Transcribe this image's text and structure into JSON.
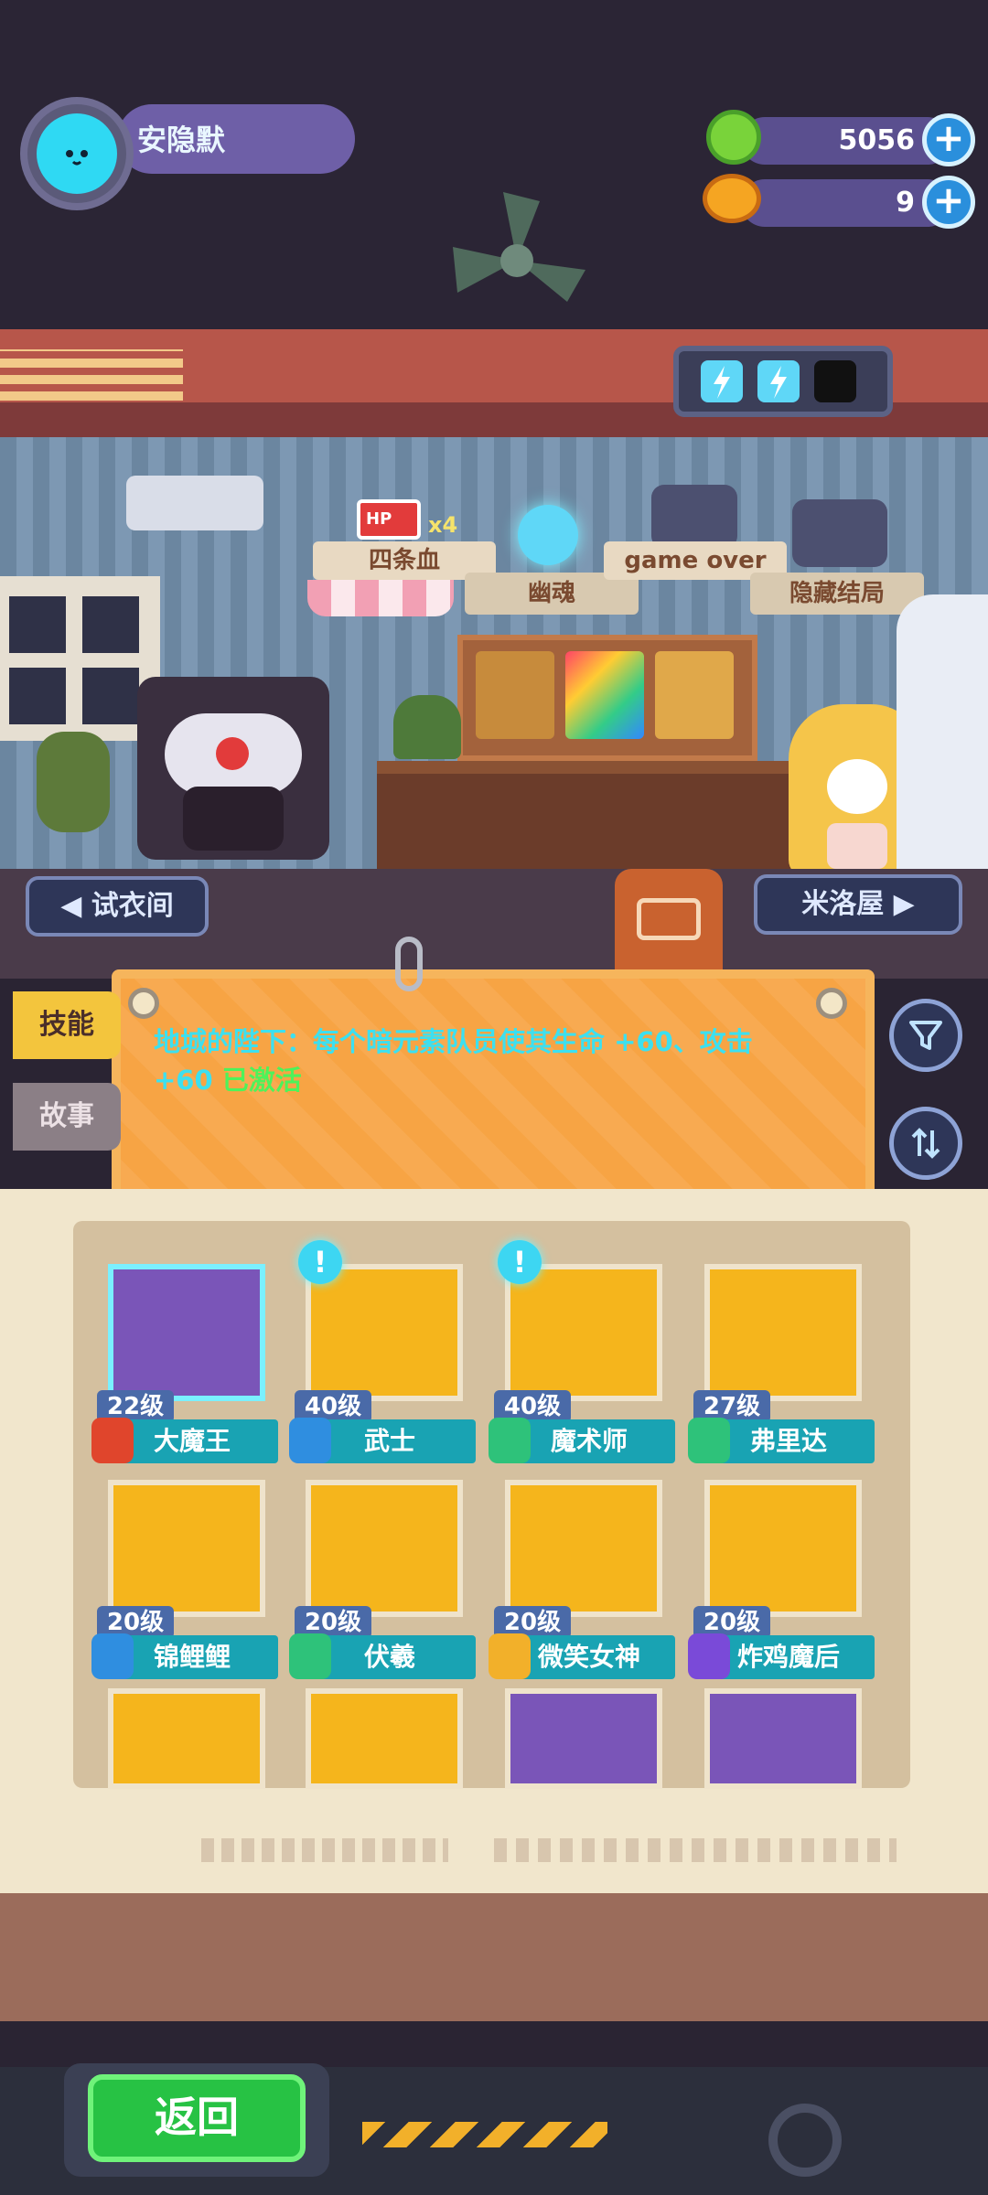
{
  "player": {
    "name": "安隐默",
    "avatar_icon": "cat-face-icon"
  },
  "resources": [
    {
      "icon": "donut-coin-icon",
      "value": "5056",
      "plus": "+"
    },
    {
      "icon": "planet-gem-icon",
      "value": "9",
      "plus": "+"
    }
  ],
  "energy": {
    "cells_full": 2,
    "cells_total": 3,
    "icon": "lightning-icon"
  },
  "achievements": [
    {
      "label": "四条血",
      "badge": "HP",
      "count": "x4"
    },
    {
      "label": "幽魂"
    },
    {
      "label": "game over"
    },
    {
      "label": "隐藏结局"
    }
  ],
  "room_buttons": {
    "left": "试衣间",
    "right": "米洛屋"
  },
  "tabs": [
    {
      "label": "技能"
    },
    {
      "label": "故事"
    }
  ],
  "skill": {
    "text": "地城的陛下：每个暗元素队员使其生命 +60、攻击 +60",
    "status": "已激活"
  },
  "characters": [
    {
      "level": "22级",
      "name": "大魔王",
      "badge_color": "#e0452c",
      "selected": true
    },
    {
      "level": "40级",
      "name": "武士",
      "badge_color": "#2f8ee0",
      "alert": "!"
    },
    {
      "level": "40级",
      "name": "魔术师",
      "badge_color": "#2ec27a",
      "alert": "!"
    },
    {
      "level": "27级",
      "name": "弗里达",
      "badge_color": "#2ec27a"
    },
    {
      "level": "20级",
      "name": "锦鲤鲤",
      "badge_color": "#2f8ee0"
    },
    {
      "level": "20级",
      "name": "伏羲",
      "badge_color": "#2ec27a"
    },
    {
      "level": "20级",
      "name": "微笑女神",
      "badge_color": "#f2b02a"
    },
    {
      "level": "20级",
      "name": "炸鸡魔后",
      "badge_color": "#7a4ad8"
    }
  ],
  "bottom": {
    "back_label": "返回"
  }
}
